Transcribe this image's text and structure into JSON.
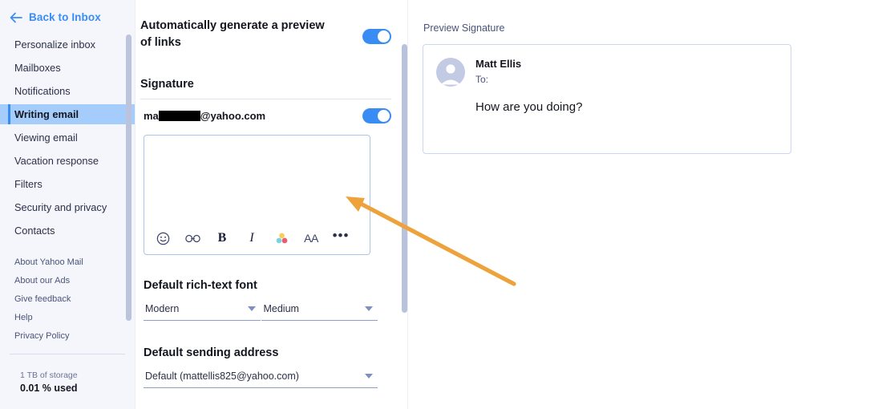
{
  "sidebar": {
    "back_link": {
      "label": "Back to Inbox",
      "icon": "arrow-left-icon"
    },
    "items": [
      {
        "label": "Personalize inbox",
        "active": false
      },
      {
        "label": "Mailboxes",
        "active": false
      },
      {
        "label": "Notifications",
        "active": false
      },
      {
        "label": "Writing email",
        "active": true
      },
      {
        "label": "Viewing email",
        "active": false
      },
      {
        "label": "Vacation response",
        "active": false
      },
      {
        "label": "Filters",
        "active": false
      },
      {
        "label": "Security and privacy",
        "active": false
      },
      {
        "label": "Contacts",
        "active": false
      }
    ],
    "links": [
      {
        "label": "About Yahoo Mail"
      },
      {
        "label": "About our Ads"
      },
      {
        "label": "Give feedback"
      },
      {
        "label": "Help"
      },
      {
        "label": "Privacy Policy"
      }
    ],
    "storage": {
      "total": "1 TB of storage",
      "used": "0.01 % used"
    }
  },
  "settings": {
    "link_preview": {
      "label": "Automatically generate a preview of links",
      "toggle_state": "on"
    },
    "signature": {
      "heading": "Signature",
      "account_prefix": "ma",
      "account_suffix": "@yahoo.com",
      "toggle_state": "on",
      "editor_value": "",
      "toolbar": [
        {
          "name": "emoji-icon",
          "label": "Emoji"
        },
        {
          "name": "link-icon",
          "label": "Link"
        },
        {
          "name": "bold-icon",
          "label": "B"
        },
        {
          "name": "italic-icon",
          "label": "I"
        },
        {
          "name": "text-color-icon",
          "label": "Color"
        },
        {
          "name": "font-size-icon",
          "label": "AA"
        },
        {
          "name": "more-options-icon",
          "label": "•••"
        }
      ]
    },
    "rich_text_font": {
      "label": "Default rich-text font",
      "family_value": "Modern",
      "size_value": "Medium"
    },
    "sending_address": {
      "label": "Default sending address",
      "value": "Default (mattellis825@yahoo.com)"
    }
  },
  "preview": {
    "title": "Preview Signature",
    "sender_name": "Matt Ellis",
    "to_label": "To:",
    "body": "How are you doing?",
    "avatar_icon": "person-avatar-icon"
  },
  "annotation": {
    "arrow_color": "#edа23c",
    "name": "orange-pointer-arrow"
  },
  "colors": {
    "accent_blue": "#3a8cf5",
    "sidebar_bg": "#f5f6fc",
    "active_item_bg": "#a4cdfb",
    "annotation_orange": "#eda23c"
  }
}
